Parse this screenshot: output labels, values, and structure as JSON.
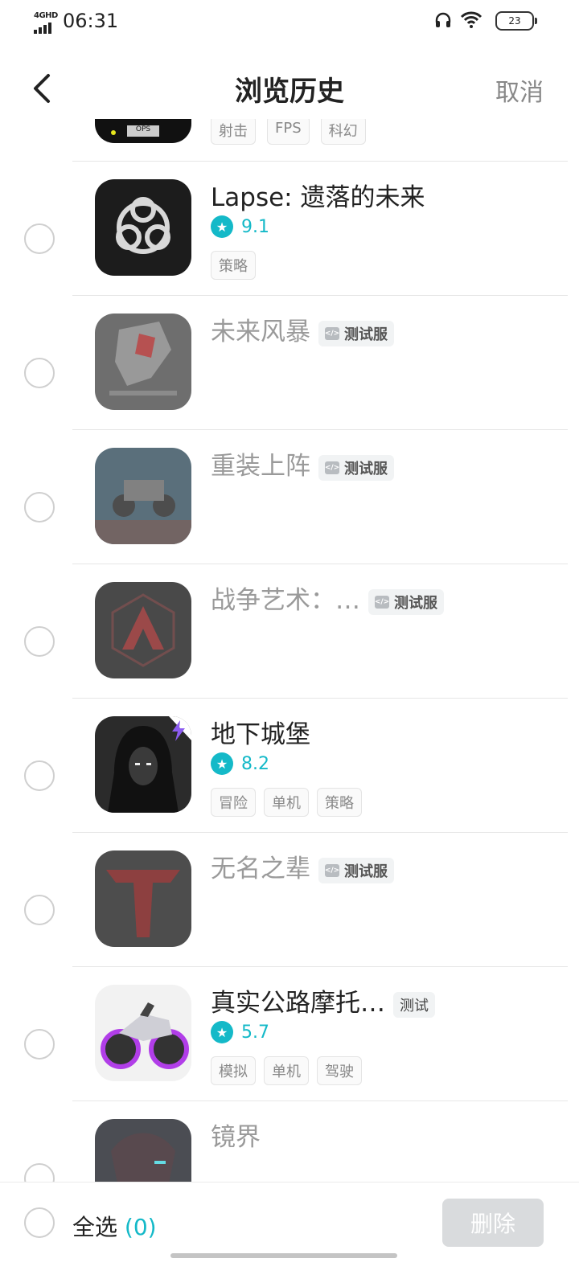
{
  "status": {
    "network": "4GHD",
    "time": "06:31",
    "battery": "23"
  },
  "header": {
    "title": "浏览历史",
    "cancel": "取消"
  },
  "partial_row": {
    "tags": [
      "射击",
      "FPS",
      "科幻"
    ]
  },
  "items": [
    {
      "name": "Lapse: 遗落的未来",
      "rating": "9.1",
      "tags": [
        "策略"
      ],
      "grayed": false,
      "badge": ""
    },
    {
      "name": "未来风暴",
      "rating": "",
      "tags": [],
      "grayed": true,
      "badge": "测试服"
    },
    {
      "name": "重装上阵",
      "rating": "",
      "tags": [],
      "grayed": true,
      "badge": "测试服"
    },
    {
      "name": "战争艺术：…",
      "rating": "",
      "tags": [],
      "grayed": true,
      "badge": "测试服"
    },
    {
      "name": "地下城堡",
      "rating": "8.2",
      "tags": [
        "冒险",
        "单机",
        "策略"
      ],
      "grayed": false,
      "badge": ""
    },
    {
      "name": "无名之辈",
      "rating": "",
      "tags": [],
      "grayed": true,
      "badge": "测试服"
    },
    {
      "name": "真实公路摩托…",
      "rating": "5.7",
      "tags": [
        "模拟",
        "单机",
        "驾驶"
      ],
      "grayed": false,
      "badge": "测试"
    },
    {
      "name": "镜界",
      "rating": "",
      "tags": [],
      "grayed": true,
      "badge": ""
    }
  ],
  "footer": {
    "select_all": "全选",
    "count": "(0)",
    "delete": "删除"
  },
  "colors": {
    "accent": "#14b9c8",
    "muted": "#9a9a9a",
    "delete_disabled": "#d9dbdd"
  },
  "icons": {
    "back": "chevron-left-icon",
    "headphones": "headphones-icon",
    "wifi": "wifi-icon",
    "star": "star-icon",
    "badge": "code-icon"
  }
}
